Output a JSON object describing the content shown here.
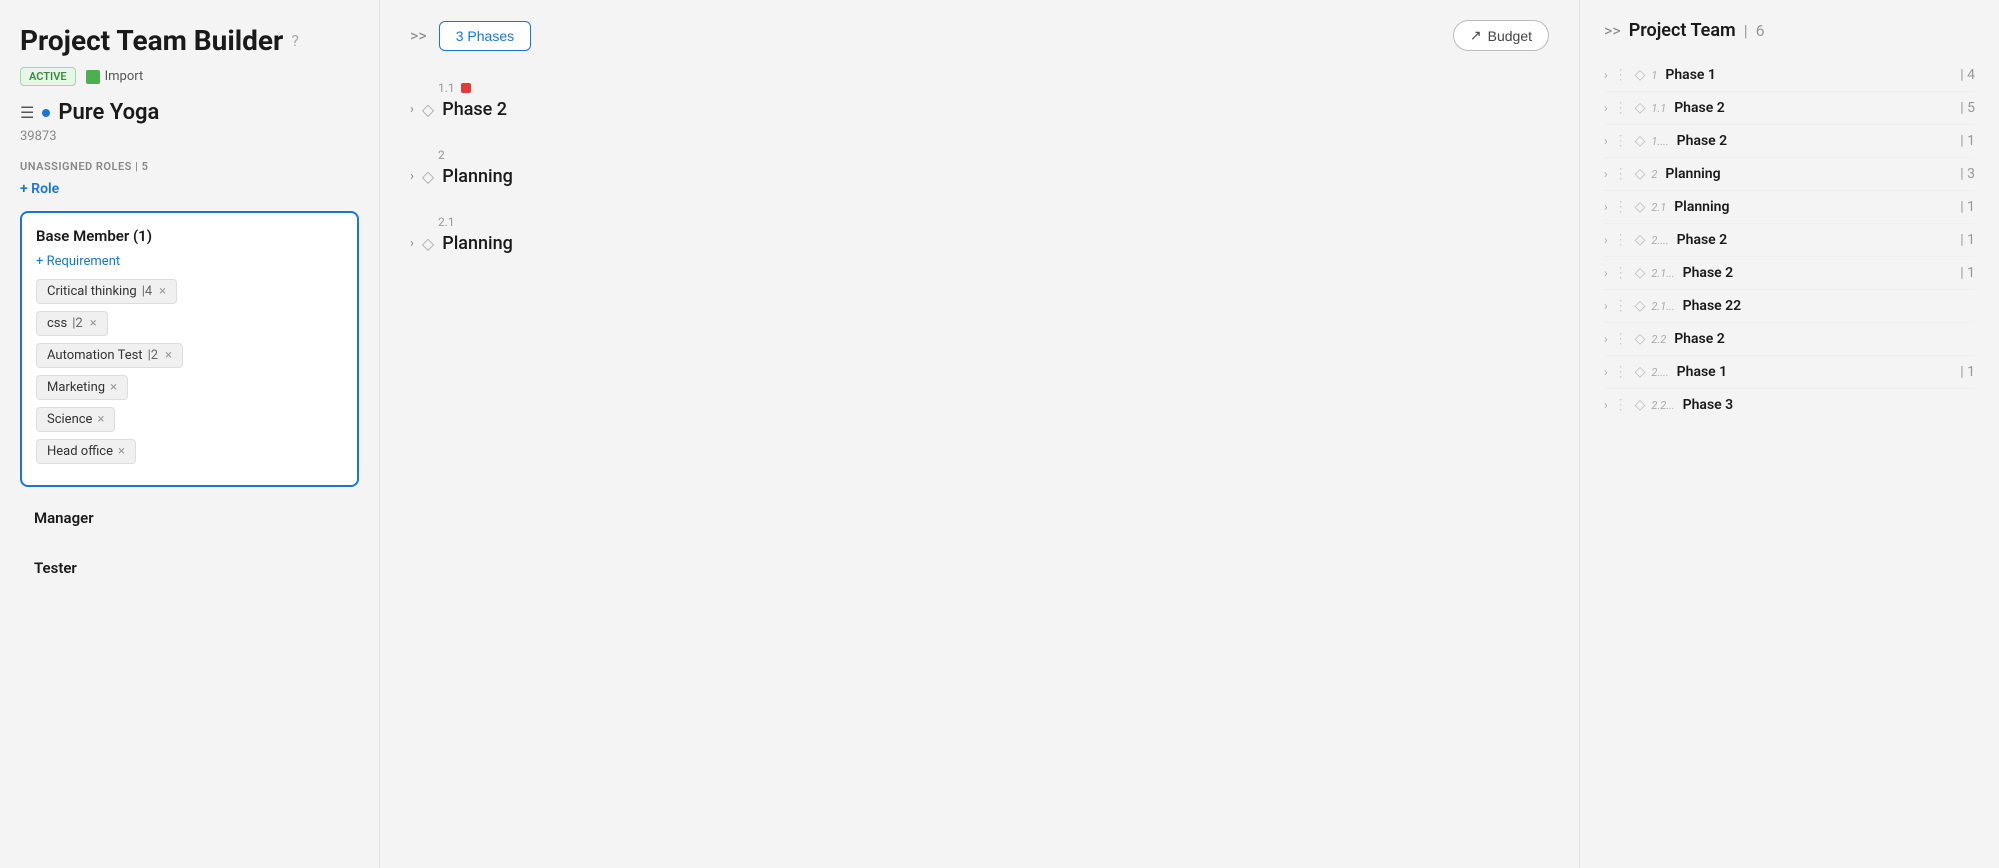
{
  "page": {
    "title": "Project Team Builder",
    "help_icon": "?",
    "badge_active": "ACTIVE",
    "import_label": "Import",
    "project_name": "Pure Yoga",
    "project_id": "39873",
    "unassigned_roles_label": "UNASSIGNED ROLES",
    "unassigned_count": "5",
    "add_role_label": "+ Role"
  },
  "role_card": {
    "title": "Base Member (1)",
    "add_requirement_label": "+ Requirement",
    "tags": [
      {
        "name": "Critical thinking",
        "count": "4",
        "has_close": true
      },
      {
        "name": "css",
        "count": "2",
        "has_close": true
      },
      {
        "name": "Automation Test",
        "count": "2",
        "has_close": true
      },
      {
        "name": "Marketing",
        "count": null,
        "has_close": true
      },
      {
        "name": "Science",
        "count": null,
        "has_close": true
      },
      {
        "name": "Head office",
        "count": null,
        "has_close": true
      }
    ]
  },
  "other_roles": [
    {
      "name": "Manager"
    },
    {
      "name": "Tester"
    }
  ],
  "middle": {
    "expand_label": ">>",
    "phases_btn": "3 Phases",
    "budget_btn": "Budget",
    "phases": [
      {
        "number": "1.1",
        "has_red_sq": true,
        "name": "Phase 2"
      },
      {
        "number": "2",
        "has_red_sq": false,
        "name": "Planning"
      },
      {
        "number": "2.1",
        "has_red_sq": false,
        "name": "Planning"
      }
    ]
  },
  "right_panel": {
    "expand_label": ">>",
    "title": "Project Team",
    "count": "6",
    "items": [
      {
        "phase_num": "1",
        "phase_name": "Phase 1",
        "count": "4"
      },
      {
        "phase_num": "1.1",
        "phase_name": "Phase 2",
        "count": "5"
      },
      {
        "phase_num": "1....",
        "phase_name": "Phase 2",
        "count": "1"
      },
      {
        "phase_num": "2",
        "phase_name": "Planning",
        "count": "3"
      },
      {
        "phase_num": "2.1",
        "phase_name": "Planning",
        "count": "1"
      },
      {
        "phase_num": "2....",
        "phase_name": "Phase 2",
        "count": "1"
      },
      {
        "phase_num": "2.1...",
        "phase_name": "Phase 2",
        "count": "1"
      },
      {
        "phase_num": "2.1...",
        "phase_name": "Phase 22",
        "count": null
      },
      {
        "phase_num": "2.2",
        "phase_name": "Phase 2",
        "count": null
      },
      {
        "phase_num": "2....",
        "phase_name": "Phase 1",
        "count": "1"
      },
      {
        "phase_num": "2.2...",
        "phase_name": "Phase 3",
        "count": null
      }
    ]
  }
}
